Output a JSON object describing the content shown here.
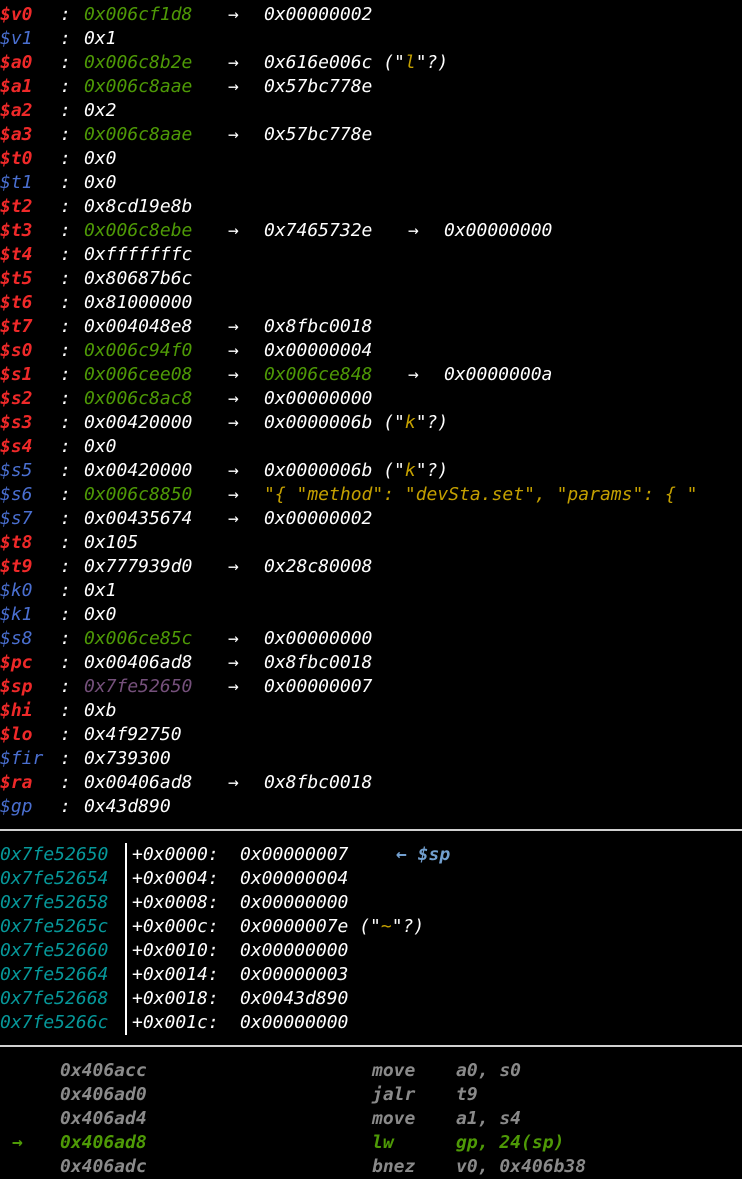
{
  "registers": [
    {
      "name": "$v0",
      "changed": true,
      "parts": [
        {
          "t": "0x006cf1d8",
          "c": "green"
        },
        {
          "t": "0x00000002",
          "c": "white"
        }
      ]
    },
    {
      "name": "$v1",
      "changed": false,
      "parts": [
        {
          "t": "0x1",
          "c": "white"
        }
      ]
    },
    {
      "name": "$a0",
      "changed": true,
      "parts": [
        {
          "t": "0x006c8b2e",
          "c": "green"
        },
        {
          "t": "0x616e006c",
          "c": "white",
          "str": "l"
        }
      ]
    },
    {
      "name": "$a1",
      "changed": true,
      "parts": [
        {
          "t": "0x006c8aae",
          "c": "green"
        },
        {
          "t": "0x57bc778e",
          "c": "white"
        }
      ]
    },
    {
      "name": "$a2",
      "changed": true,
      "parts": [
        {
          "t": "0x2",
          "c": "white"
        }
      ]
    },
    {
      "name": "$a3",
      "changed": true,
      "parts": [
        {
          "t": "0x006c8aae",
          "c": "green"
        },
        {
          "t": "0x57bc778e",
          "c": "white"
        }
      ]
    },
    {
      "name": "$t0",
      "changed": true,
      "parts": [
        {
          "t": "0x0",
          "c": "white"
        }
      ]
    },
    {
      "name": "$t1",
      "changed": false,
      "parts": [
        {
          "t": "0x0",
          "c": "white"
        }
      ]
    },
    {
      "name": "$t2",
      "changed": true,
      "parts": [
        {
          "t": "0x8cd19e8b",
          "c": "white"
        }
      ]
    },
    {
      "name": "$t3",
      "changed": true,
      "parts": [
        {
          "t": "0x006c8ebe",
          "c": "green"
        },
        {
          "t": "0x7465732e",
          "c": "white"
        },
        {
          "t": "0x00000000",
          "c": "white"
        }
      ]
    },
    {
      "name": "$t4",
      "changed": true,
      "parts": [
        {
          "t": "0xfffffffc",
          "c": "white"
        }
      ]
    },
    {
      "name": "$t5",
      "changed": true,
      "parts": [
        {
          "t": "0x80687b6c",
          "c": "white"
        }
      ]
    },
    {
      "name": "$t6",
      "changed": true,
      "parts": [
        {
          "t": "0x81000000",
          "c": "white"
        }
      ]
    },
    {
      "name": "$t7",
      "changed": true,
      "parts": [
        {
          "t": "0x004048e8",
          "c": "white"
        },
        {
          "t": "0x8fbc0018",
          "c": "white"
        }
      ]
    },
    {
      "name": "$s0",
      "changed": true,
      "parts": [
        {
          "t": "0x006c94f0",
          "c": "green"
        },
        {
          "t": "0x00000004",
          "c": "white"
        }
      ]
    },
    {
      "name": "$s1",
      "changed": true,
      "parts": [
        {
          "t": "0x006cee08",
          "c": "green"
        },
        {
          "t": "0x006ce848",
          "c": "green"
        },
        {
          "t": "0x0000000a",
          "c": "white"
        }
      ]
    },
    {
      "name": "$s2",
      "changed": true,
      "parts": [
        {
          "t": "0x006c8ac8",
          "c": "green"
        },
        {
          "t": "0x00000000",
          "c": "white"
        }
      ]
    },
    {
      "name": "$s3",
      "changed": true,
      "parts": [
        {
          "t": "0x00420000",
          "c": "white"
        },
        {
          "t": "0x0000006b",
          "c": "white",
          "str": "k"
        }
      ]
    },
    {
      "name": "$s4",
      "changed": true,
      "parts": [
        {
          "t": "0x0",
          "c": "white"
        }
      ]
    },
    {
      "name": "$s5",
      "changed": false,
      "parts": [
        {
          "t": "0x00420000",
          "c": "white"
        },
        {
          "t": "0x0000006b",
          "c": "white",
          "str": "k"
        }
      ]
    },
    {
      "name": "$s6",
      "changed": false,
      "parts": [
        {
          "t": "0x006c8850",
          "c": "green"
        },
        {
          "t": "\"{ \"method\": \"devSta.set\", \"params\": { \"",
          "c": "yellow"
        }
      ]
    },
    {
      "name": "$s7",
      "changed": false,
      "parts": [
        {
          "t": "0x00435674",
          "c": "white"
        },
        {
          "t": "0x00000002",
          "c": "white"
        }
      ]
    },
    {
      "name": "$t8",
      "changed": true,
      "parts": [
        {
          "t": "0x105",
          "c": "white"
        }
      ]
    },
    {
      "name": "$t9",
      "changed": true,
      "parts": [
        {
          "t": "0x777939d0",
          "c": "white"
        },
        {
          "t": "0x28c80008",
          "c": "white"
        }
      ]
    },
    {
      "name": "$k0",
      "changed": false,
      "parts": [
        {
          "t": "0x1",
          "c": "white"
        }
      ]
    },
    {
      "name": "$k1",
      "changed": false,
      "parts": [
        {
          "t": "0x0",
          "c": "white"
        }
      ]
    },
    {
      "name": "$s8",
      "changed": false,
      "parts": [
        {
          "t": "0x006ce85c",
          "c": "green"
        },
        {
          "t": "0x00000000",
          "c": "white"
        }
      ]
    },
    {
      "name": "$pc",
      "changed": true,
      "parts": [
        {
          "t": "0x00406ad8",
          "c": "white"
        },
        {
          "t": "0x8fbc0018",
          "c": "white"
        }
      ]
    },
    {
      "name": "$sp",
      "changed": true,
      "parts": [
        {
          "t": "0x7fe52650",
          "c": "purple"
        },
        {
          "t": "0x00000007",
          "c": "white"
        }
      ]
    },
    {
      "name": "$hi",
      "changed": true,
      "parts": [
        {
          "t": "0xb",
          "c": "white"
        }
      ]
    },
    {
      "name": "$lo",
      "changed": true,
      "parts": [
        {
          "t": "0x4f92750",
          "c": "white"
        }
      ]
    },
    {
      "name": "$fir",
      "changed": false,
      "parts": [
        {
          "t": "0x739300",
          "c": "white"
        }
      ]
    },
    {
      "name": "$ra",
      "changed": true,
      "parts": [
        {
          "t": "0x00406ad8",
          "c": "white"
        },
        {
          "t": "0x8fbc0018",
          "c": "white"
        }
      ]
    },
    {
      "name": "$gp",
      "changed": false,
      "parts": [
        {
          "t": "0x43d890",
          "c": "white"
        }
      ]
    }
  ],
  "stack": [
    {
      "addr": "0x7fe52650",
      "off": "+0x0000:",
      "val": "0x00000007",
      "note": "← $sp"
    },
    {
      "addr": "0x7fe52654",
      "off": "+0x0004:",
      "val": "0x00000004"
    },
    {
      "addr": "0x7fe52658",
      "off": "+0x0008:",
      "val": "0x00000000"
    },
    {
      "addr": "0x7fe5265c",
      "off": "+0x000c:",
      "val": "0x0000007e",
      "str": "~"
    },
    {
      "addr": "0x7fe52660",
      "off": "+0x0010:",
      "val": "0x00000000"
    },
    {
      "addr": "0x7fe52664",
      "off": "+0x0014:",
      "val": "0x00000003"
    },
    {
      "addr": "0x7fe52668",
      "off": "+0x0018:",
      "val": "0x0043d890"
    },
    {
      "addr": "0x7fe5266c",
      "off": "+0x001c:",
      "val": "0x00000000"
    }
  ],
  "code": [
    {
      "addr": "0x406acc",
      "mnem": "move",
      "ops": "a0, s0",
      "current": false
    },
    {
      "addr": "0x406ad0",
      "mnem": "jalr",
      "ops": "t9",
      "current": false
    },
    {
      "addr": "0x406ad4",
      "mnem": "move",
      "ops": "a1, s4",
      "current": false
    },
    {
      "addr": "0x406ad8",
      "mnem": "lw",
      "ops": "gp, 24(sp)",
      "current": true
    },
    {
      "addr": "0x406adc",
      "mnem": "bnez",
      "ops": "v0, 0x406b38",
      "current": false
    }
  ],
  "symbols": {
    "colon": ":",
    "arrow": "→",
    "current_marker": "→"
  },
  "colors": {
    "background": "#000000",
    "register_changed": "#ef2929",
    "register_same": "#4a6fd0",
    "heap_pointer": "#4e9a06",
    "stack_pointer": "#75507b",
    "string": "#c4a000",
    "stack_address": "#06989a",
    "code_dim": "#8a8a8a"
  }
}
